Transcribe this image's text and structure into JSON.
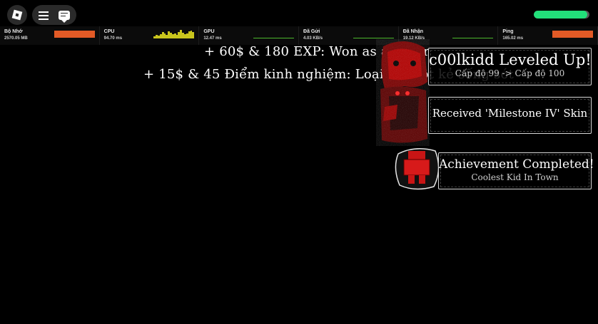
{
  "topbar": {
    "roblox_menu_icon": "roblox-logo-icon",
    "menu_icon": "hamburger-icon",
    "chat_icon": "chat-icon",
    "health_fraction": 0.96,
    "health_color": "#22e07a"
  },
  "stats": [
    {
      "label": "Bộ Nhớ",
      "value": "2570.05 MB",
      "graph": "solid",
      "color": "#e25a26"
    },
    {
      "label": "CPU",
      "value": "94.70 ms",
      "graph": "bars",
      "color": "#c9c51d"
    },
    {
      "label": "GPU",
      "value": "12.47 ms",
      "graph": "line",
      "color": "#4cb82d"
    },
    {
      "label": "Đã Gửi",
      "value": "4.03 KB/s",
      "graph": "line",
      "color": "#4cb82d"
    },
    {
      "label": "Đã Nhận",
      "value": "19.12 KB/s",
      "graph": "line",
      "color": "#4cb82d"
    },
    {
      "label": "Ping",
      "value": "165.02 ms",
      "graph": "solid",
      "color": "#e25a26"
    }
  ],
  "messages": {
    "won_killer": "+ 60$ & 180 EXP: Won as a Killer",
    "eliminated": "+ 15$ & 45 Điểm kinh nghiệm: Loại bỏ một kẻ sống sót"
  },
  "notifications": {
    "level_up": {
      "title": "c00lkidd Leveled Up!",
      "subtitle": "Cấp độ 99 -> Cấp độ 100"
    },
    "skin": {
      "title": "Received 'Milestone IV' Skin"
    },
    "achievement": {
      "title": "Achievement Completed!",
      "subtitle": "Coolest Kid In Town"
    }
  }
}
